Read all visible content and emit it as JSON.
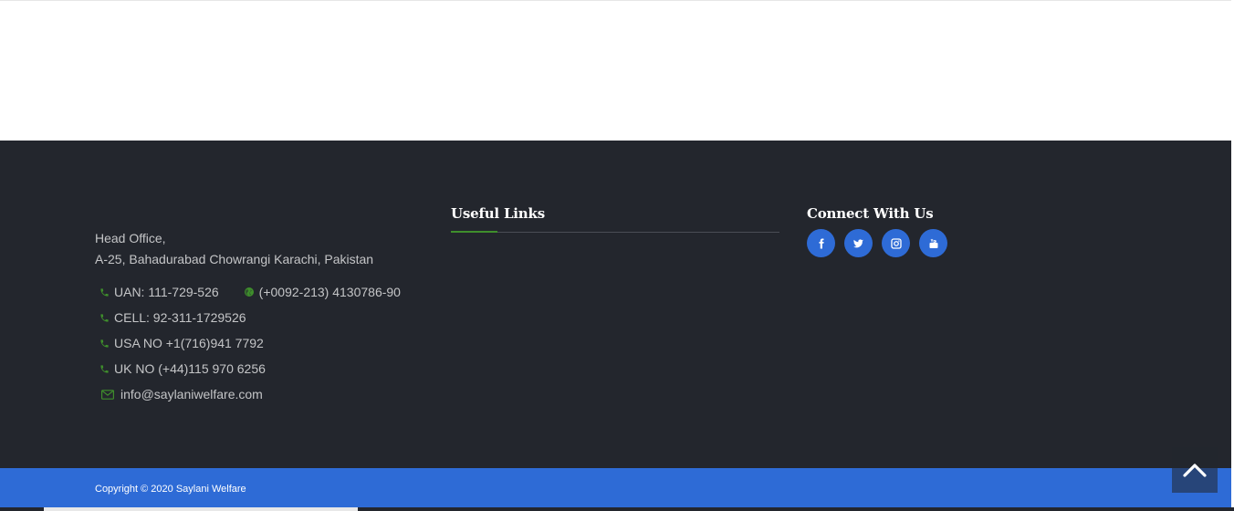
{
  "contact": {
    "head_office_line1": "Head Office,",
    "head_office_line2": "A-25, Bahadurabad Chowrangi Karachi, Pakistan",
    "uan": "UAN: 111-729-526",
    "landline": "(+0092-213) 4130786-90",
    "cell": "CELL: 92-311-1729526",
    "usa": "USA NO +1(716)941 7792",
    "uk": "UK NO (+44)115 970 6256",
    "email": "info@saylaniwelfare.com",
    "icons": {
      "phone": "phone-icon",
      "globe": "globe-icon",
      "email": "envelope-icon"
    },
    "icon_color": "#3f8e2c"
  },
  "useful_links": {
    "title": "Useful Links"
  },
  "connect": {
    "title": "Connect With Us",
    "socials": [
      {
        "icon": "facebook-icon"
      },
      {
        "icon": "twitter-icon"
      },
      {
        "icon": "instagram-icon"
      },
      {
        "icon": "youtube-icon"
      }
    ]
  },
  "footer_bottom": {
    "copyright": "Copyright © 2020 Saylani Welfare"
  },
  "back_to_top": {
    "icon": "chevron-up-icon"
  },
  "colors": {
    "footer_bg": "#23262d",
    "brand_blue": "#2e6bd6",
    "accent_green": "#3f8e2c",
    "title_white": "#ffffff"
  }
}
